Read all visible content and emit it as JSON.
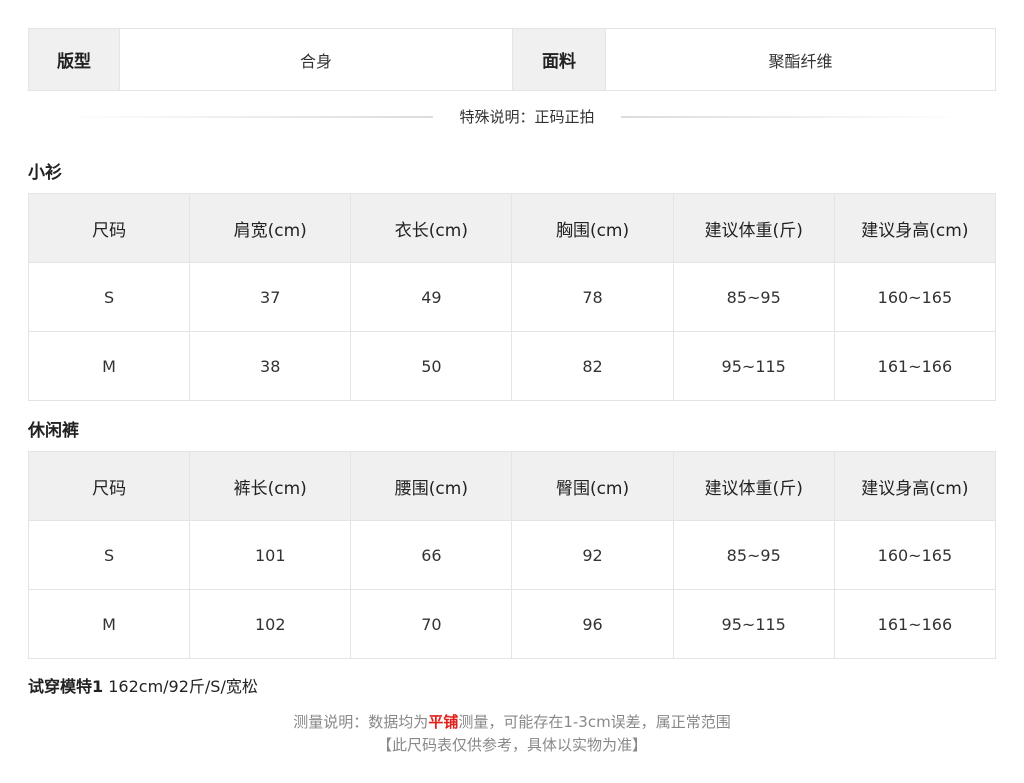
{
  "info": {
    "fit_label": "版型",
    "fit_value": "合身",
    "fabric_label": "面料",
    "fabric_value": "聚酯纤维"
  },
  "note": "特殊说明：正码正拍",
  "top": {
    "title": "小衫",
    "headers": [
      "尺码",
      "肩宽(cm)",
      "衣长(cm)",
      "胸围(cm)",
      "建议体重(斤)",
      "建议身高(cm)"
    ],
    "rows": [
      [
        "S",
        "37",
        "49",
        "78",
        "85~95",
        "160~165"
      ],
      [
        "M",
        "38",
        "50",
        "82",
        "95~115",
        "161~166"
      ]
    ]
  },
  "pants": {
    "title": "休闲裤",
    "headers": [
      "尺码",
      "裤长(cm)",
      "腰围(cm)",
      "臀围(cm)",
      "建议体重(斤)",
      "建议身高(cm)"
    ],
    "rows": [
      [
        "S",
        "101",
        "66",
        "92",
        "85~95",
        "160~165"
      ],
      [
        "M",
        "102",
        "70",
        "96",
        "95~115",
        "161~166"
      ]
    ]
  },
  "model": {
    "label": "试穿模特1",
    "value": "162cm/92斤/S/宽松"
  },
  "footer": {
    "prefix": "测量说明：数据均为",
    "highlight": "平铺",
    "suffix": "测量，可能存在1-3cm误差，属正常范围",
    "line2": "【此尺码表仅供参考，具体以实物为准】"
  }
}
